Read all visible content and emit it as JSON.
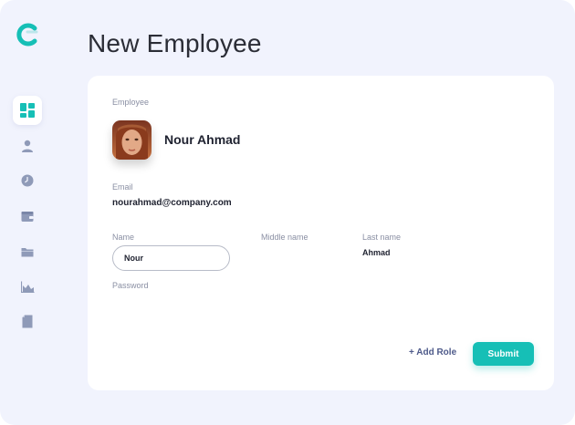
{
  "page": {
    "title": "New Employee"
  },
  "sidebar": {
    "items": [
      {
        "icon": "dashboard-icon",
        "active": true
      },
      {
        "icon": "user-icon",
        "active": false
      },
      {
        "icon": "clock-icon",
        "active": false
      },
      {
        "icon": "wallet-icon",
        "active": false
      },
      {
        "icon": "folder-icon",
        "active": false
      },
      {
        "icon": "chart-icon",
        "active": false
      },
      {
        "icon": "document-icon",
        "active": false
      }
    ]
  },
  "form": {
    "employee_label": "Employee",
    "employee_name": "Nour Ahmad",
    "email_label": "Email",
    "email_value": "nourahmad@company.com",
    "name_label": "Name",
    "name_value": "Nour",
    "middle_name_label": "Middle name",
    "last_name_label": "Last name",
    "last_name_value": "Ahmad",
    "password_label": "Password"
  },
  "actions": {
    "add_role_label": "+ Add Role",
    "submit_label": "Submit"
  },
  "colors": {
    "accent": "#16bfb6",
    "background": "#f1f3fd",
    "icon": "#8f9ab8",
    "active_icon": "#16bfb6"
  }
}
